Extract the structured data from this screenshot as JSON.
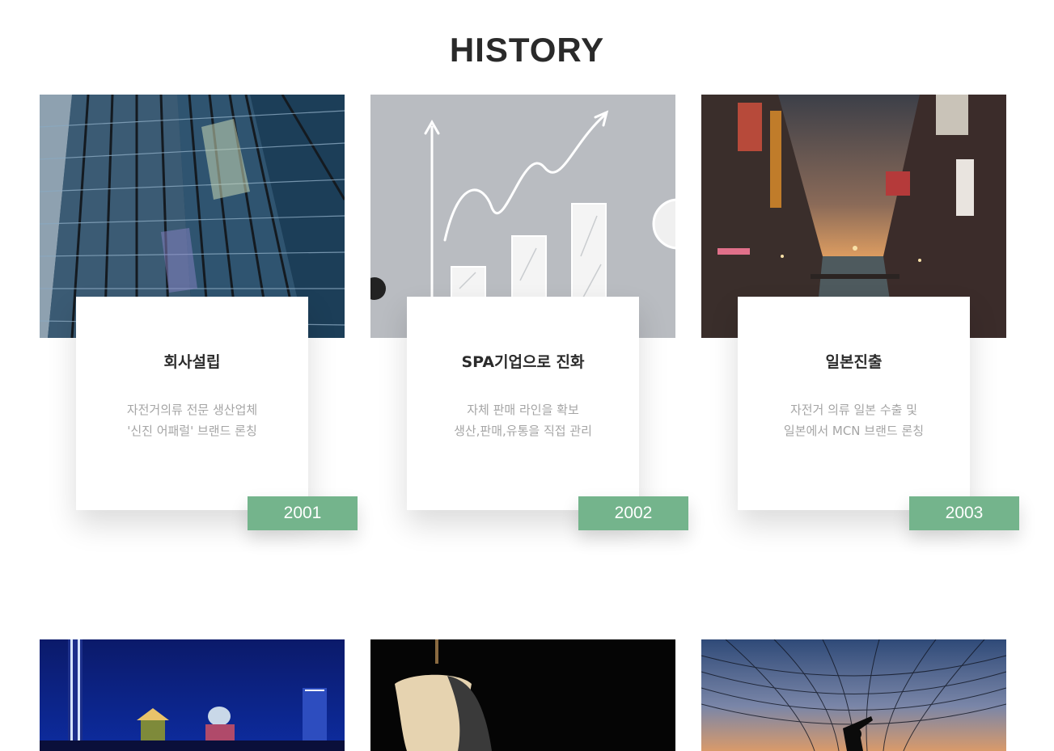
{
  "section": {
    "title": "HISTORY"
  },
  "history": [
    {
      "title": "회사설립",
      "desc": [
        "자전거의류 전문 생산업체",
        "'신진 어패럴' 브랜드 론칭"
      ],
      "year": "2001",
      "image": "glass-skyscraper-photo"
    },
    {
      "title": "SPA기업으로 진화",
      "desc": [
        "자체 판매 라인을 확보",
        "생산,판매,유통을 직접 관리"
      ],
      "year": "2002",
      "image": "growth-chart-sketch-photo"
    },
    {
      "title": "일본진출",
      "desc": [
        "자전거 의류 일본 수출 및",
        "일본에서 MCN 브랜드 론칭"
      ],
      "year": "2003",
      "image": "osaka-canal-street-photo"
    }
  ],
  "next_row_images": [
    "night-city-skyline-photo",
    "dress-mannequin-photo",
    "net-sunset-silhouette-photo"
  ],
  "colors": {
    "accent": "#74b48c",
    "title": "#2a2a2a",
    "desc": "#a5a5a5"
  }
}
